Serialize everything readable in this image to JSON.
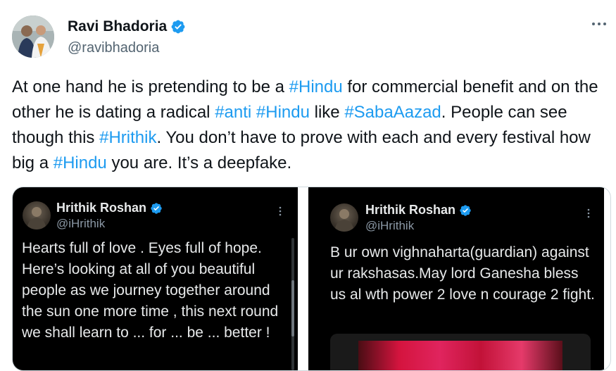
{
  "author": {
    "display_name": "Ravi Bhadoria",
    "handle": "@ravibhadoria",
    "verified": true,
    "avatar_icon": "profile-photo"
  },
  "more_icon": "more-horizontal-icon",
  "tweet_text": {
    "s1": "At one hand he is pretending to be a ",
    "h1": "#Hindu",
    "s2": " for commercial benefit and on the other he is dating a radical ",
    "h2": "#anti",
    "s3": " ",
    "h3": "#Hindu",
    "s4": " like ",
    "h4": "#SabaAazad",
    "s5": ". People can see though this ",
    "h5": "#Hrithik",
    "s6": ". You don’t have to prove with each and every festival how big a ",
    "h6": "#Hindu",
    "s7": " you are. It’s a deepfake."
  },
  "media": {
    "left": {
      "name": "Hrithik Roshan",
      "handle": "@iHrithik",
      "text": "Hearts full of love . Eyes full of hope. Here’s looking at all of you beautiful people as we journey together around the sun one more time , this next round we shall learn to ... for ... be ... better !"
    },
    "right": {
      "name": "Hrithik Roshan",
      "handle": "@iHrithik",
      "text": "B ur own vighnaharta(guardian) against ur rakshasas.May lord Ganesha bless us al wth power 2 love n courage 2 fight."
    }
  },
  "colors": {
    "hashtag": "#1d9bf0",
    "verified": "#1d9bf0",
    "text": "#0f1419",
    "secondary": "#536471"
  }
}
